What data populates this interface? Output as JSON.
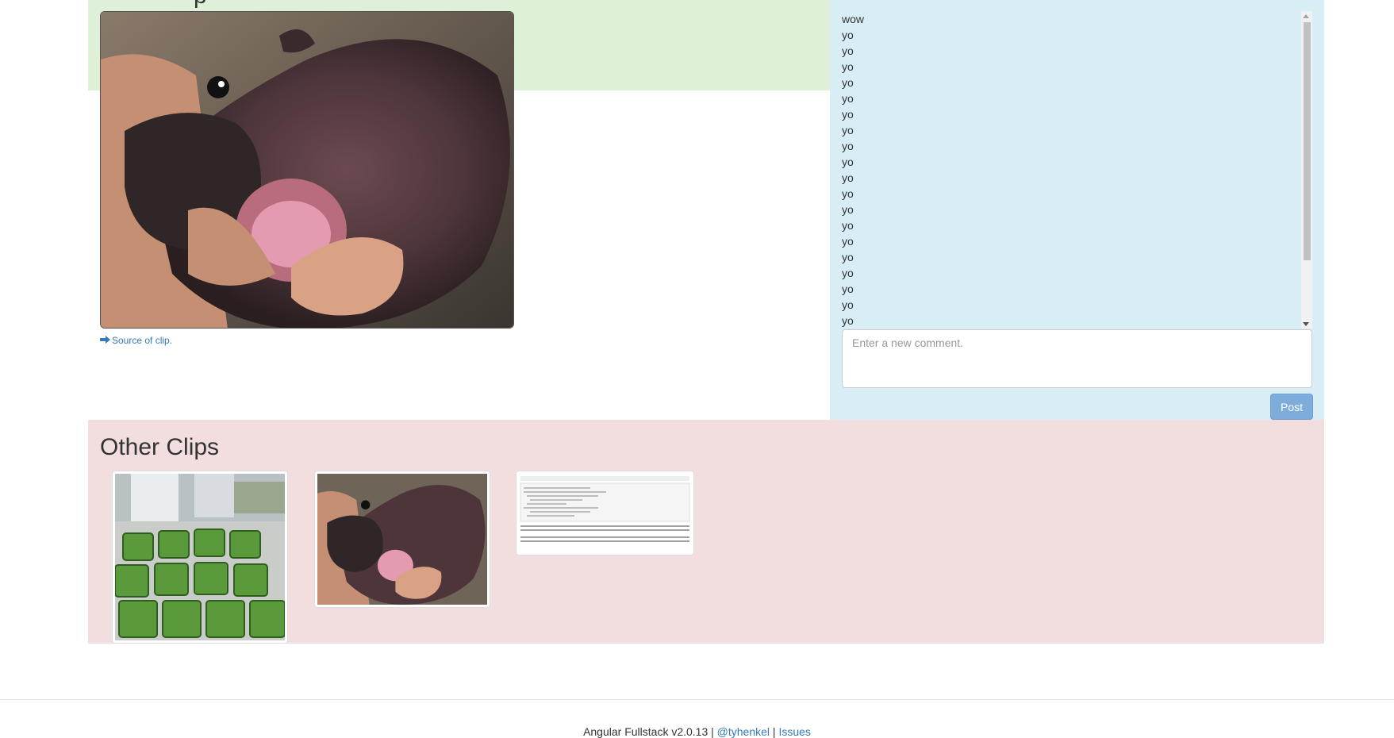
{
  "clip": {
    "title_fragment": "p",
    "main_image_alt": "baby hippo in hand",
    "source_link_label": "Source of clip.",
    "source_icon": "arrow-right-icon"
  },
  "comments": {
    "items": [
      "wow",
      "yo",
      "yo",
      "yo",
      "yo",
      "yo",
      "yo",
      "yo",
      "yo",
      "yo",
      "yo",
      "yo",
      "yo",
      "yo",
      "yo",
      "yo",
      "yo",
      "yo",
      "yo",
      "yo"
    ],
    "placeholder": "Enter a new comment.",
    "post_label": "Post"
  },
  "other_clips": {
    "title": "Other Clips",
    "thumbnails": [
      {
        "name": "square-watermelons"
      },
      {
        "name": "baby-hippo"
      },
      {
        "name": "code-documentation"
      }
    ]
  },
  "footer": {
    "prefix": "Angular Fullstack v2.0.13 | ",
    "author_link": "@tyhenkel",
    "separator": " | ",
    "issues_link": "Issues"
  },
  "colors": {
    "clip_band": "#dff0d8",
    "comments_panel": "#d9edf7",
    "other_clips_panel": "#f2dede",
    "link": "#337ab7",
    "post_button": "#7faddb"
  }
}
